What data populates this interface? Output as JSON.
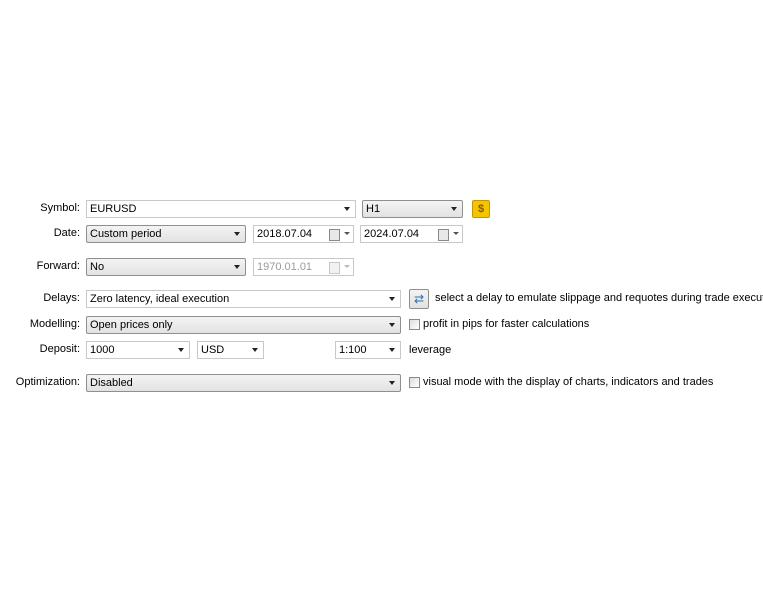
{
  "symbol": {
    "label": "Symbol:",
    "value": "EURUSD",
    "period": "H1",
    "icon": "dollar-icon"
  },
  "date": {
    "label": "Date:",
    "mode": "Custom period",
    "from": "2018.07.04",
    "to": "2024.07.04"
  },
  "forward": {
    "label": "Forward:",
    "value": "No",
    "date": "1970.01.01"
  },
  "delays": {
    "label": "Delays:",
    "value": "Zero latency, ideal execution",
    "hint": "select a delay to emulate slippage and requotes during trade execution",
    "icon": "delay-settings-icon"
  },
  "modelling": {
    "label": "Modelling:",
    "value": "Open prices only",
    "checkbox_label": "profit in pips for faster calculations",
    "checked": false
  },
  "deposit": {
    "label": "Deposit:",
    "value": "1000",
    "currency": "USD",
    "leverage": "1:100",
    "leverage_label": "leverage"
  },
  "optimization": {
    "label": "Optimization:",
    "value": "Disabled",
    "checkbox_label": "visual mode with the display of charts, indicators and trades",
    "checked": false
  },
  "colors": {
    "accent_icon": "#f5c400"
  }
}
